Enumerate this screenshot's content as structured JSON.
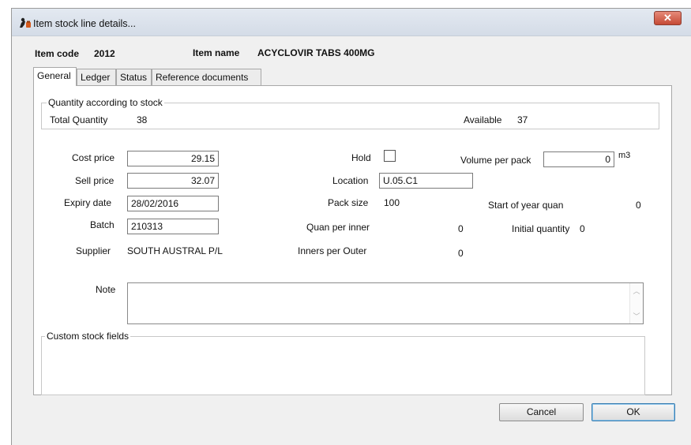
{
  "window": {
    "title": "Item stock line details..."
  },
  "header": {
    "item_code_label": "Item code",
    "item_code": "2012",
    "item_name_label": "Item name",
    "item_name": "ACYCLOVIR TABS 400MG"
  },
  "tabs": [
    {
      "label": "General",
      "active": true
    },
    {
      "label": "Ledger"
    },
    {
      "label": "Status"
    },
    {
      "label": "Reference documents"
    }
  ],
  "quantity_group": {
    "title": "Quantity according to stock",
    "total_label": "Total Quantity",
    "total_value": "38",
    "available_label": "Available",
    "available_value": "37"
  },
  "form": {
    "cost_price_label": "Cost price",
    "cost_price": "29.15",
    "sell_price_label": "Sell price",
    "sell_price": "32.07",
    "expiry_label": "Expiry date",
    "expiry": "28/02/2016",
    "batch_label": "Batch",
    "batch": "210313",
    "supplier_label": "Supplier",
    "supplier": "SOUTH AUSTRAL P/L",
    "hold_label": "Hold",
    "hold_checked": false,
    "location_label": "Location",
    "location": "U.05.C1",
    "pack_size_label": "Pack size",
    "pack_size": "100",
    "quan_per_inner_label": "Quan per inner",
    "quan_per_inner": "0",
    "inners_per_outer_label": "Inners per Outer",
    "inners_per_outer": "0",
    "volume_label": "Volume per pack",
    "volume": "0",
    "volume_unit": "m3",
    "start_of_year_label": "Start of year quan",
    "start_of_year": "0",
    "initial_qty_label": "Initial quantity",
    "initial_qty": "0",
    "note_label": "Note",
    "note": ""
  },
  "custom_fields": {
    "title": "Custom stock fields"
  },
  "buttons": {
    "cancel": "Cancel",
    "ok": "OK"
  },
  "icons": {
    "app": "drug-bottle-icon",
    "close": "close-icon",
    "scroll_up": "chevron-up-icon",
    "scroll_down": "chevron-down-icon"
  },
  "colors": {
    "close_button": "#c44a35",
    "default_button_border": "#3c7fb1"
  }
}
